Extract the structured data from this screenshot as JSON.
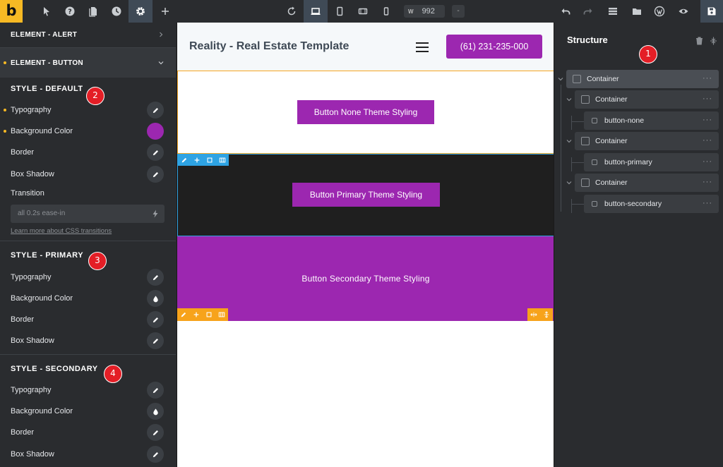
{
  "topbar": {
    "logo": "b",
    "width_label": "W",
    "width_value": "992",
    "width_unit": "-"
  },
  "left_panel": {
    "accordions": [
      {
        "label": "ELEMENT - ALERT"
      },
      {
        "label": "ELEMENT - BUTTON"
      }
    ],
    "sections": [
      {
        "title": "STYLE - DEFAULT",
        "badge": "2",
        "props": [
          {
            "label": "Typography",
            "control": "pencil",
            "changed": true
          },
          {
            "label": "Background Color",
            "control": "swatch",
            "changed": true,
            "swatch_color": "#9c27b0"
          },
          {
            "label": "Border",
            "control": "pencil",
            "changed": false
          },
          {
            "label": "Box Shadow",
            "control": "pencil",
            "changed": false
          }
        ],
        "transition_label": "Transition",
        "transition_placeholder": "all 0.2s ease-in",
        "learn_more": "Learn more about CSS transitions"
      },
      {
        "title": "STYLE - PRIMARY",
        "badge": "3",
        "props": [
          {
            "label": "Typography",
            "control": "pencil"
          },
          {
            "label": "Background Color",
            "control": "drop"
          },
          {
            "label": "Border",
            "control": "pencil"
          },
          {
            "label": "Box Shadow",
            "control": "pencil"
          }
        ]
      },
      {
        "title": "STYLE - SECONDARY",
        "badge": "4",
        "props": [
          {
            "label": "Typography",
            "control": "pencil"
          },
          {
            "label": "Background Color",
            "control": "drop"
          },
          {
            "label": "Border",
            "control": "pencil"
          },
          {
            "label": "Box Shadow",
            "control": "pencil"
          }
        ]
      }
    ]
  },
  "canvas": {
    "site_title": "Reality - Real Estate Template",
    "phone_button": "(61) 231-235-000",
    "button_none": "Button None Theme Styling",
    "button_primary": "Button Primary Theme Styling",
    "button_secondary": "Button Secondary Theme Styling"
  },
  "structure": {
    "title": "Structure",
    "badge": "1",
    "nodes": [
      {
        "label": "Container"
      },
      {
        "label": "Container"
      },
      {
        "label": "button-none"
      },
      {
        "label": "Container"
      },
      {
        "label": "button-primary"
      },
      {
        "label": "Container"
      },
      {
        "label": "button-secondary"
      }
    ],
    "more": "···"
  },
  "colors": {
    "accent": "#f7b924",
    "brand_purple": "#9c27b0",
    "panel_bg": "#2a2c2f",
    "badge_red": "#e41e26",
    "selection_blue": "#2ea3e3"
  }
}
